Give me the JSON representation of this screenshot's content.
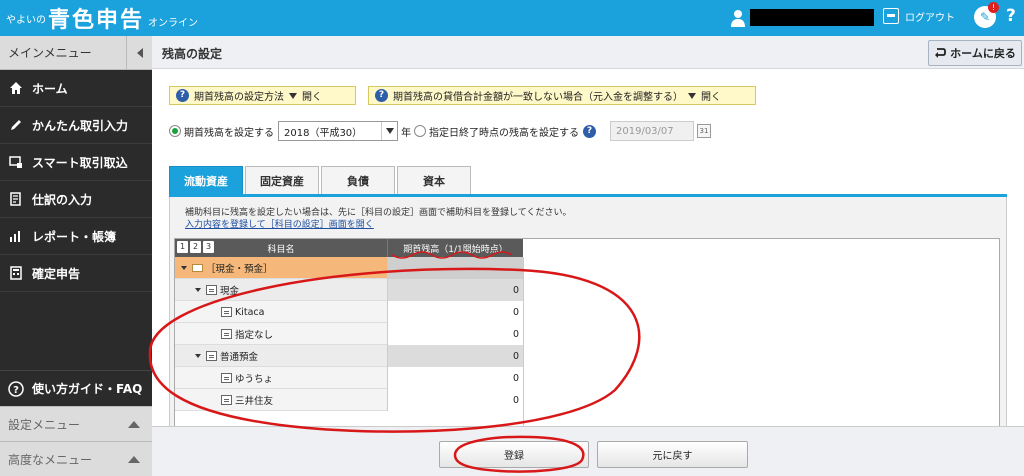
{
  "header": {
    "logo_prefix": "やよいの",
    "logo_main": "青色申告",
    "logo_suffix": "オンライン",
    "logout_label": "ログアウト",
    "notification_count": "!",
    "help_label": "?"
  },
  "sidebar": {
    "main_menu_label": "メインメニュー",
    "items": [
      {
        "icon": "home-icon",
        "label": "ホーム"
      },
      {
        "icon": "pencil-icon",
        "label": "かんたん取引入力"
      },
      {
        "icon": "import-icon",
        "label": "スマート取引取込"
      },
      {
        "icon": "journal-icon",
        "label": "仕訳の入力"
      },
      {
        "icon": "chart-icon",
        "label": "レポート・帳簿"
      },
      {
        "icon": "calculator-icon",
        "label": "確定申告"
      }
    ],
    "guide_label": "使い方ガイド・FAQ",
    "settings_menu_label": "設定メニュー",
    "advanced_menu_label": "高度なメニュー"
  },
  "page": {
    "title": "残高の設定",
    "home_button": "ホームに戻る",
    "info1_label": "期首残高の設定方法",
    "info1_action": "開く",
    "info2_label": "期首残高の貸借合計金額が一致しない場合（元入金を調整する）",
    "info2_action": "開く",
    "option1_label": "期首残高を設定する",
    "year_selected": "2018（平成30）",
    "year_suffix": "年",
    "option2_label": "指定日終了時点の残高を設定する",
    "date_value": "2019/03/07",
    "calendar_label": "31",
    "note_text": "補助科目に残高を設定したい場合は、先に［科目の設定］画面で補助科目を登録してください。",
    "note_link": "入力内容を登録して［科目の設定］画面を開く"
  },
  "tabs": [
    "流動資産",
    "固定資産",
    "負債",
    "資本"
  ],
  "grid": {
    "page_nums": [
      "1",
      "2",
      "3"
    ],
    "col_name": "科目名",
    "col_value": "期首残高（1/1開始時点）",
    "rows": [
      {
        "name": "［現金・預金］",
        "value": ""
      },
      {
        "name": "現金",
        "value": "0"
      },
      {
        "name": "Kitaca",
        "value": "0"
      },
      {
        "name": "指定なし",
        "value": "0"
      },
      {
        "name": "普通預金",
        "value": "0"
      },
      {
        "name": "ゆうちょ",
        "value": "0"
      },
      {
        "name": "三井住友",
        "value": "0"
      }
    ]
  },
  "footer": {
    "register_button": "登録",
    "back_button": "元に戻す"
  },
  "colors": {
    "brand_blue": "#1ba2dc",
    "sidebar_dark": "#2b2b2b",
    "folder_row": "#f5b87a",
    "annotation_red": "#d81818"
  }
}
